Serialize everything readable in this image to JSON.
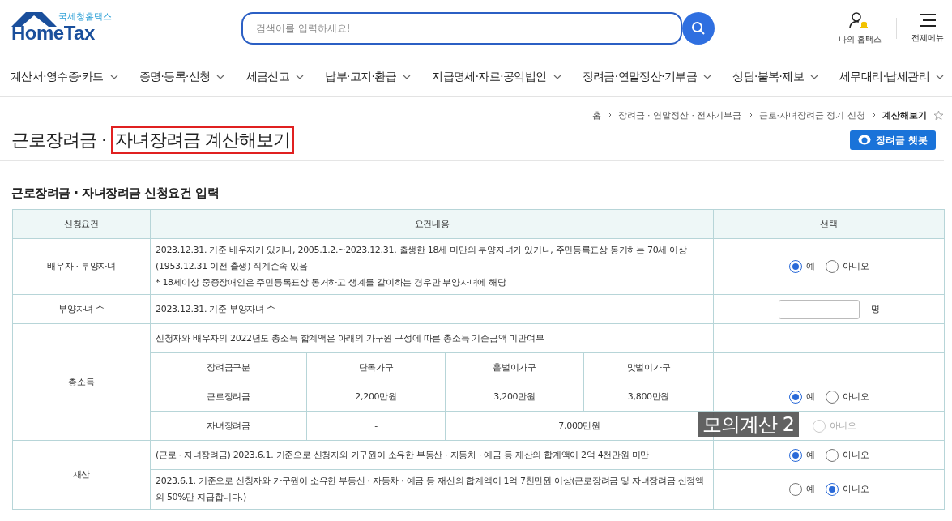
{
  "header": {
    "logo": {
      "subtitle": "국세청홈택스",
      "name": "HomeTax"
    },
    "search": {
      "placeholder": "검색어를 입력하세요!"
    },
    "actions": [
      {
        "kind": "user",
        "label": "나의 홈택스"
      },
      {
        "kind": "menu",
        "label": "전체메뉴"
      }
    ]
  },
  "nav": [
    "계산서·영수증·카드",
    "증명·등록·신청",
    "세금신고",
    "납부·고지·환급",
    "지급명세·자료·공익법인",
    "장려금·연말정산·기부금",
    "상담·불복·제보",
    "세무대리·납세관리"
  ],
  "breadcrumb": [
    "홈",
    "장려금 · 연말정산 · 전자기부금",
    "근로·자녀장려금 정기 신청",
    "계산해보기"
  ],
  "title": {
    "text": "근로장려금 ·",
    "highlight": "자녀장려금 계산해보기"
  },
  "chatbot_button": "장려금 챗봇",
  "section_title": "근로장려금 · 자녀장려금 신청요건 입력",
  "table": {
    "columns": [
      "신청요건",
      "요건내용",
      "선택"
    ],
    "rows": [
      {
        "kind": "radio",
        "label": "배우자 · 부양자녀",
        "lines": [
          "2023.12.31. 기준 배우자가 있거나, 2005.1.2.~2023.12.31. 출생한 18세 미만의 부양자녀가 있거나, 주민등록표상 동거하는 70세 이상(1953.12.31 이전 출생) 직계존속 있음",
          "* 18세이상 중증장애인은 주민등록표상 동거하고 생계를 같이하는 경우만 부양자녀에 해당"
        ],
        "options": [
          {
            "label": "예",
            "selected": true
          },
          {
            "label": "아니오",
            "selected": false
          }
        ]
      },
      {
        "kind": "count",
        "label": "부양자녀 수",
        "lines": [
          "2023.12.31. 기준 부양자녀 수"
        ],
        "unit": "명"
      },
      {
        "kind": "income",
        "label": "총소득",
        "lines": [
          "신청자와 배우자의 2022년도 총소득 합계액은 아래의 가구원 구성에 따른 총소득 기준금액 미만여부"
        ],
        "columns": [
          "장려금구분",
          "단독가구",
          "홑벌이가구",
          "맞벌이가구"
        ],
        "subrows": [
          {
            "cells": [
              "근로장려금",
              "2,200만원",
              "3,200만원",
              "3,800만원"
            ],
            "disabled": false,
            "options": [
              {
                "label": "예",
                "selected": true
              },
              {
                "label": "아니오",
                "selected": false
              }
            ]
          },
          {
            "cells": [
              "자녀장려금",
              "-",
              "7,000만원"
            ],
            "disabled": true,
            "options": [
              {
                "label": "아니오",
                "selected": false
              }
            ]
          }
        ]
      },
      {
        "kind": "asset",
        "label": "재산",
        "items": [
          {
            "text": "(근로 · 자녀장려금) 2023.6.1. 기준으로 신청자와 가구원이 소유한 부동산 · 자동차 · 예금 등 재산의 합계액이 2억 4천만원 미만",
            "options": [
              {
                "label": "예",
                "selected": true
              },
              {
                "label": "아니오",
                "selected": false
              }
            ]
          },
          {
            "text": "2023.6.1. 기준으로 신청자와 가구원이 소유한 부동산 · 자동차 · 예금 등 재산의 합계액이 1억 7천만원 이상(근로장려금 및 자녀장려금 산정액의 50%만 지급합니다.)",
            "options": [
              {
                "label": "예",
                "selected": false
              },
              {
                "label": "아니오",
                "selected": true
              }
            ]
          }
        ]
      }
    ]
  },
  "overlay_label": "모의계산 2"
}
